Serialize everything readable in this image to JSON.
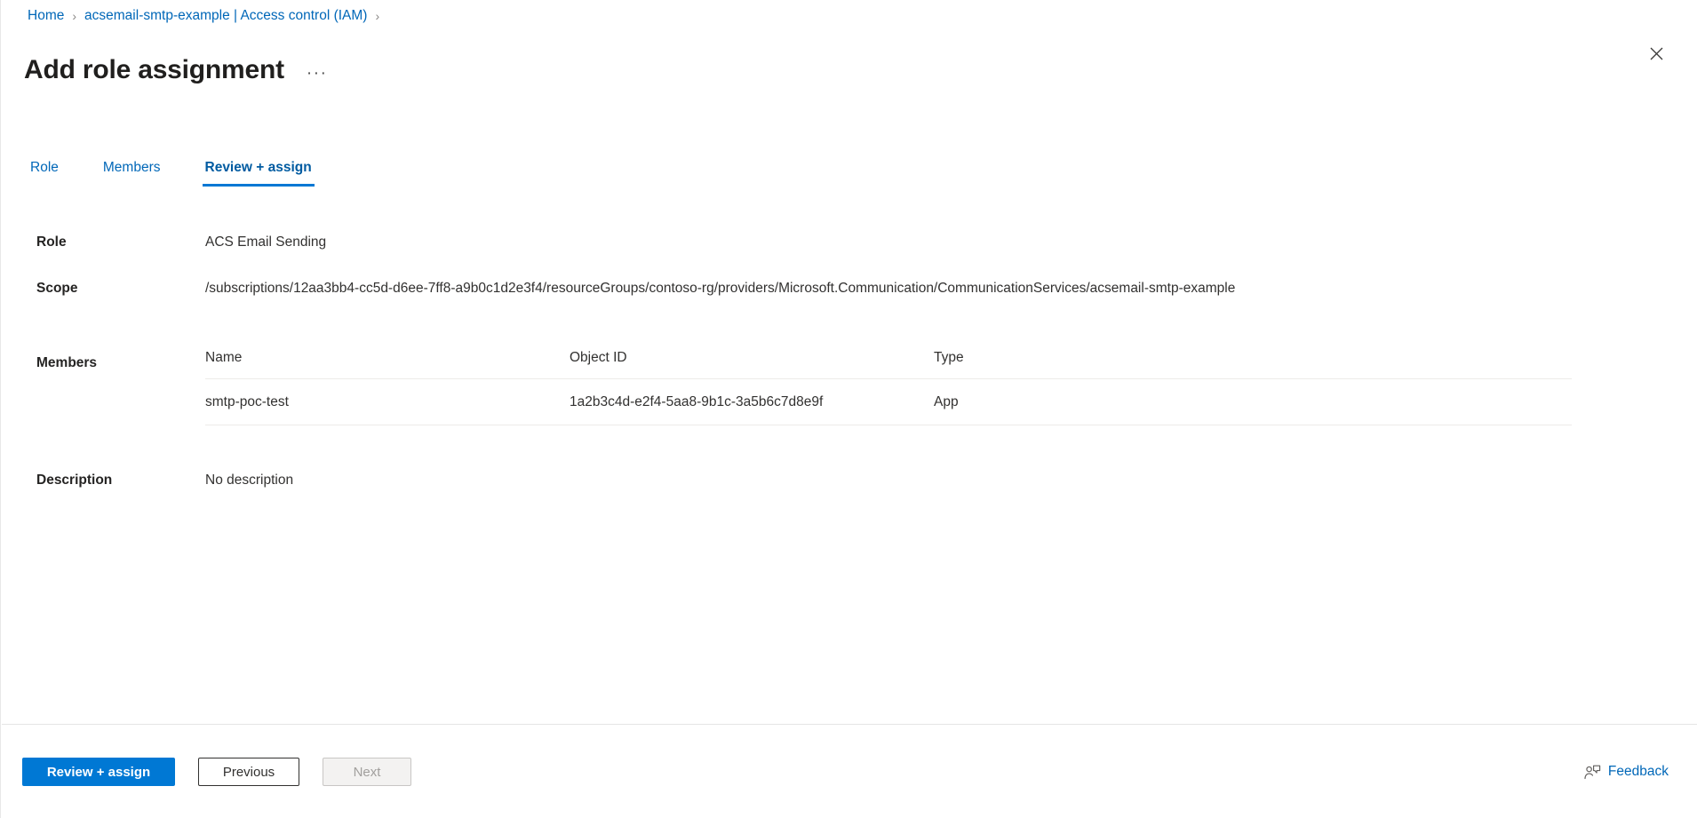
{
  "breadcrumb": {
    "items": [
      {
        "label": "Home"
      },
      {
        "label": "acsemail-smtp-example | Access control (IAM)"
      }
    ],
    "separator": "›"
  },
  "header": {
    "title": "Add role assignment",
    "more_menu_label": "···",
    "close_icon": "close-icon"
  },
  "tabs": [
    {
      "label": "Role",
      "active": false
    },
    {
      "label": "Members",
      "active": false
    },
    {
      "label": "Review + assign",
      "active": true
    }
  ],
  "summary": {
    "role": {
      "label": "Role",
      "value": "ACS Email Sending"
    },
    "scope": {
      "label": "Scope",
      "value": "/subscriptions/12aa3bb4-cc5d-d6ee-7ff8-a9b0c1d2e3f4/resourceGroups/contoso-rg/providers/Microsoft.Communication/CommunicationServices/acsemail-smtp-example"
    },
    "members": {
      "label": "Members",
      "columns": [
        "Name",
        "Object ID",
        "Type"
      ],
      "rows": [
        {
          "name": "smtp-poc-test",
          "object_id": "1a2b3c4d-e2f4-5aa8-9b1c-3a5b6c7d8e9f",
          "type": "App"
        }
      ]
    },
    "description": {
      "label": "Description",
      "value": "No description"
    }
  },
  "footer": {
    "primary_button": "Review + assign",
    "previous_button": "Previous",
    "next_button": "Next",
    "feedback_label": "Feedback",
    "feedback_icon": "feedback-person-icon"
  },
  "colors": {
    "accent": "#0078d4",
    "link": "#0067b8",
    "text": "#323130",
    "divider": "#edebe9",
    "disabled_text": "#a19f9d"
  }
}
